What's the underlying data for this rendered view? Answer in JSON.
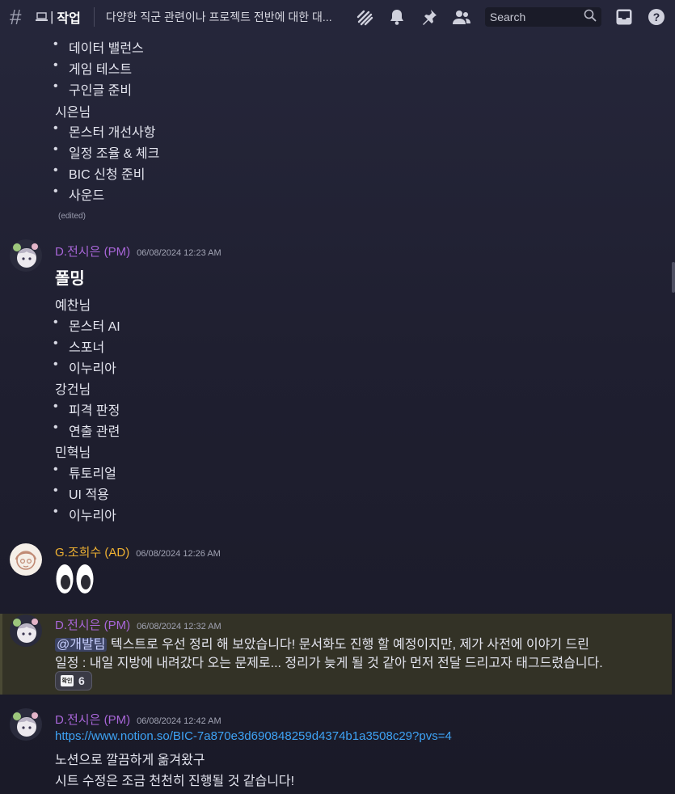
{
  "header": {
    "channel_name": "작업",
    "topic": "다양한 직군 관련이나 프로젝트 전반에 대한 대...",
    "search_placeholder": "Search"
  },
  "top_block": {
    "items_a": [
      "데이터 밸런스",
      "게임 테스트",
      "구인글 준비"
    ],
    "person": "시은님",
    "items_b": [
      "몬스터 개선사항",
      "일정 조율 & 체크",
      "BIC 신청 준비",
      "사운드"
    ],
    "edited": "(edited)"
  },
  "messages": [
    {
      "author": "D.전시은 (PM)",
      "author_color": "#a866d8",
      "timestamp": "06/08/2024 12:23 AM",
      "heading": "폴밍",
      "groups": [
        {
          "person": "예찬님",
          "items": [
            "몬스터 AI",
            "스포너",
            "이누리아"
          ]
        },
        {
          "person": "강건님",
          "items": [
            "피격 판정",
            "연출 관련"
          ]
        },
        {
          "person": "민혁님",
          "items": [
            "튜토리얼",
            "UI 적용",
            "이누리아"
          ]
        }
      ]
    },
    {
      "author": "G.조희수 (AD)",
      "author_color": "#f0b232",
      "timestamp": "06/08/2024 12:26 AM",
      "emoji": "eyes-emoji"
    },
    {
      "author": "D.전시은 (PM)",
      "author_color": "#a866d8",
      "timestamp": "06/08/2024 12:32 AM",
      "mention": "@개발팀",
      "line1": " 텍스트로 우선 정리 해 보았습니다! 문서화도 진행 할 예정이지만, 제가 사전에 이야기 드린",
      "line2": "일정 : 내일 지방에 내려갔다 오는 문제로... 정리가 늦게 될 것 같아 먼저 전달 드리고자 태그드렸습니다.",
      "reaction": {
        "label": "확인",
        "count": "6"
      }
    },
    {
      "author": "D.전시은 (PM)",
      "author_color": "#a866d8",
      "timestamp": "06/08/2024 12:42 AM",
      "link": "https://www.notion.so/BIC-7a870e3d690848259d4374b1a3508c29?pvs=4",
      "line1": "노션으로 깔끔하게 옮겨왔구",
      "line2": "시트 수정은 조금 천천히 진행될 것 같습니다!"
    }
  ]
}
